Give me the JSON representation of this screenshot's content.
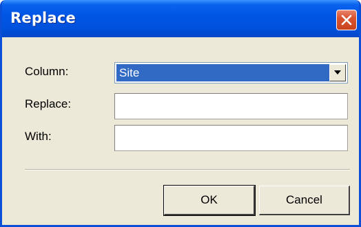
{
  "window": {
    "title": "Replace"
  },
  "form": {
    "column_label": "Column:",
    "column_value": "Site",
    "replace_label": "Replace:",
    "replace_value": "",
    "with_label": "With:",
    "with_value": ""
  },
  "buttons": {
    "ok_label": "OK",
    "cancel_label": "Cancel"
  },
  "icons": {
    "close": "close-icon",
    "dropdown": "chevron-down-icon"
  },
  "colors": {
    "titlebar": "#0055e5",
    "close_button": "#d9532f",
    "selection": "#316ac5",
    "dialog_background": "#ece9d8"
  }
}
